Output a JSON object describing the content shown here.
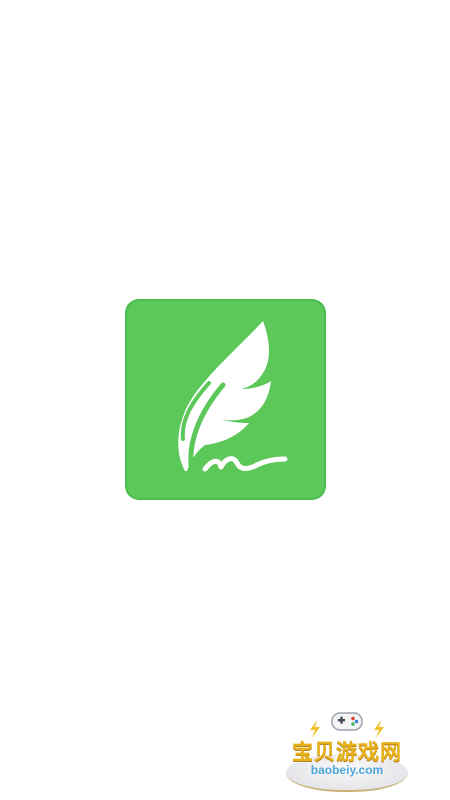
{
  "splash": {
    "logo_icon": "feather-quill-icon",
    "logo_color": "#5cc85a"
  },
  "watermark": {
    "title": "宝贝游戏网",
    "url": "baobeiy.com",
    "icon": "gamepad-icon",
    "title_color": "#e8b21a",
    "url_color": "#4fa7d8"
  }
}
